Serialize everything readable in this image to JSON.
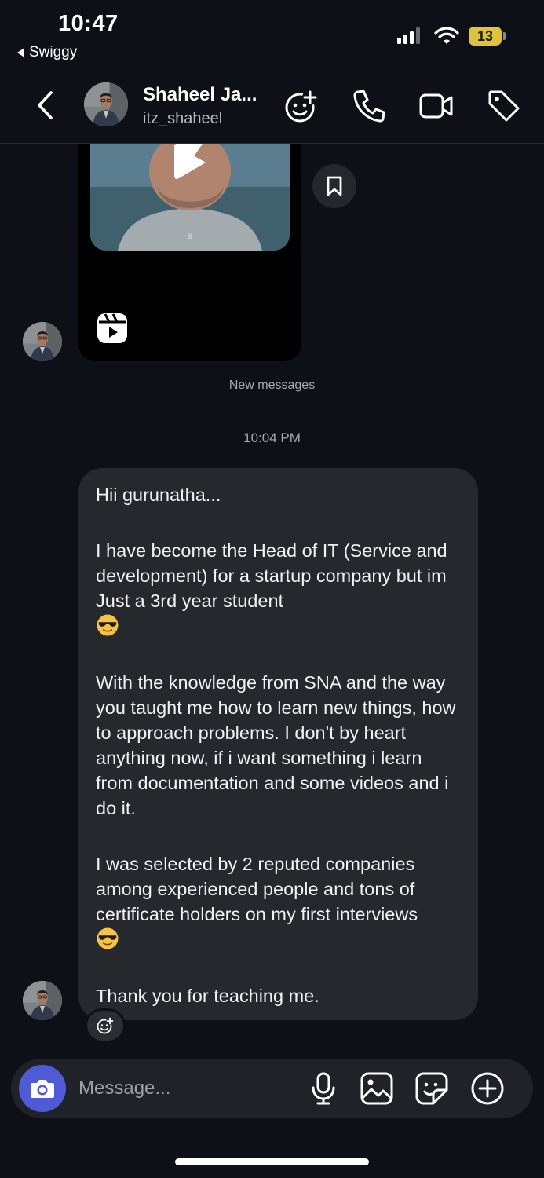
{
  "status_bar": {
    "time": "10:47",
    "back_app": "Swiggy",
    "battery": "13"
  },
  "header": {
    "contact_name": "Shaheel Ja...",
    "username": "itz_shaheel",
    "icons": [
      "chevron-left-icon",
      "add-reaction-icon",
      "phone-icon",
      "video-camera-icon",
      "tag-icon"
    ]
  },
  "conversation": {
    "divider_label": "New messages",
    "timestamp": "10:04 PM",
    "message": {
      "p1": "Hii gurunatha...",
      "p2": "I have become the Head of IT (Service and development) for a startup company but im Just a 3rd year student",
      "p3": "With the  knowledge from SNA and the way you taught me how to learn new things, how to approach problems. I don't by heart anything now, if i want something i learn from documentation and some videos and i do it.",
      "p4": "I was selected by 2 reputed companies among experienced people and tons of certificate holders on my first interviews",
      "p5": "Thank you for teaching me.",
      "emoji": "sunglasses-emoji"
    }
  },
  "composer": {
    "placeholder": "Message...",
    "icons": [
      "camera-icon",
      "microphone-icon",
      "gallery-icon",
      "sticker-icon",
      "plus-circle-icon"
    ]
  },
  "colors": {
    "background": "#0d1117",
    "bubble": "#25282d",
    "camera_button": "#4f5bd5",
    "battery": "#e0c33a"
  }
}
